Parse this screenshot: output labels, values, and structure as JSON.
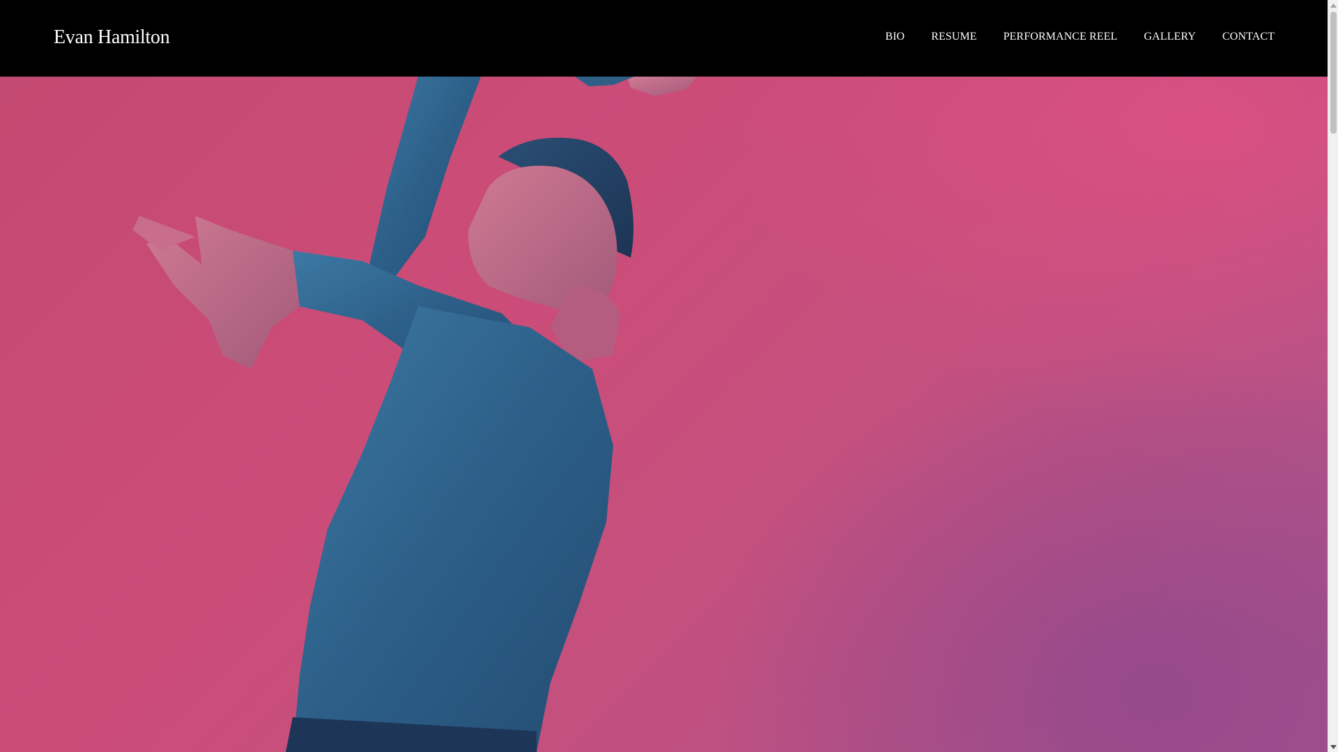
{
  "site": {
    "title": "Evan Hamilton"
  },
  "nav": {
    "items": [
      {
        "label": "BIO",
        "name": "nav-bio"
      },
      {
        "label": "RESUME",
        "name": "nav-resume"
      },
      {
        "label": "PERFORMANCE REEL",
        "name": "nav-performance-reel"
      },
      {
        "label": "GALLERY",
        "name": "nav-gallery"
      },
      {
        "label": "CONTACT",
        "name": "nav-contact"
      }
    ]
  },
  "hero": {
    "background_color": "#c84c78",
    "figure_color": "#2f5f86"
  },
  "colors": {
    "header_background": "#000000",
    "header_text": "#ffffff"
  },
  "scrollbar": {
    "icons": [
      "chevron-up-icon",
      "chevron-down-icon"
    ]
  }
}
